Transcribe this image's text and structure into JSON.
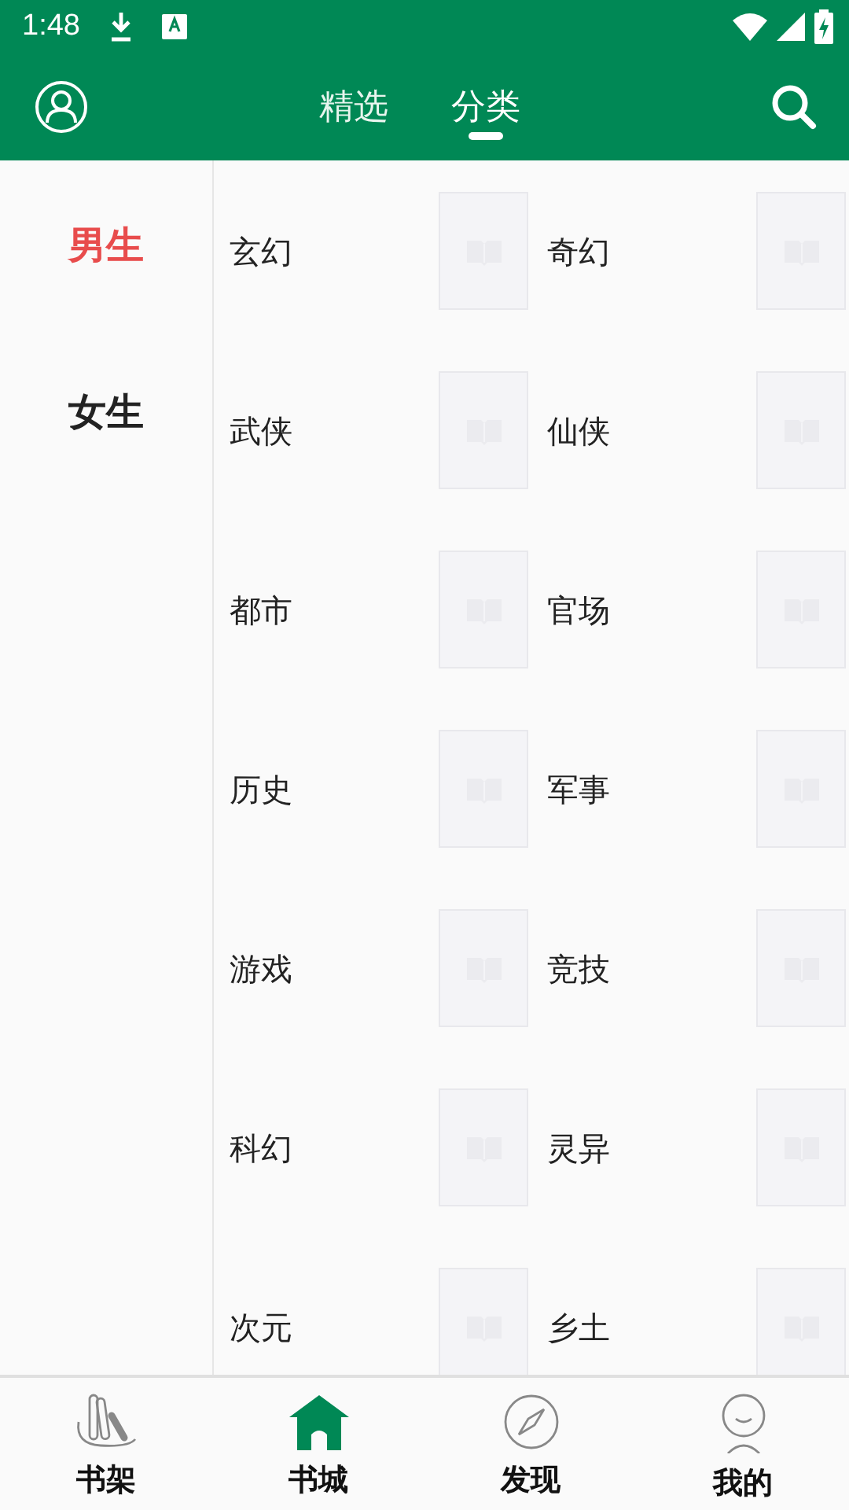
{
  "status_bar": {
    "time": "1:48"
  },
  "header": {
    "tabs": [
      {
        "label": "精选",
        "selected": false
      },
      {
        "label": "分类",
        "selected": true
      }
    ]
  },
  "sidebar": {
    "items": [
      {
        "label": "男生",
        "selected": true
      },
      {
        "label": "女生",
        "selected": false
      }
    ]
  },
  "categories": [
    {
      "label": "玄幻"
    },
    {
      "label": "奇幻"
    },
    {
      "label": "武侠"
    },
    {
      "label": "仙侠"
    },
    {
      "label": "都市"
    },
    {
      "label": "官场"
    },
    {
      "label": "历史"
    },
    {
      "label": "军事"
    },
    {
      "label": "游戏"
    },
    {
      "label": "竞技"
    },
    {
      "label": "科幻"
    },
    {
      "label": "灵异"
    },
    {
      "label": "次元"
    },
    {
      "label": "乡土"
    }
  ],
  "bottom_nav": [
    {
      "label": "书架",
      "kind": "shelf",
      "selected": false
    },
    {
      "label": "书城",
      "kind": "store",
      "selected": true
    },
    {
      "label": "发现",
      "kind": "discover",
      "selected": false
    },
    {
      "label": "我的",
      "kind": "me",
      "selected": false
    }
  ]
}
